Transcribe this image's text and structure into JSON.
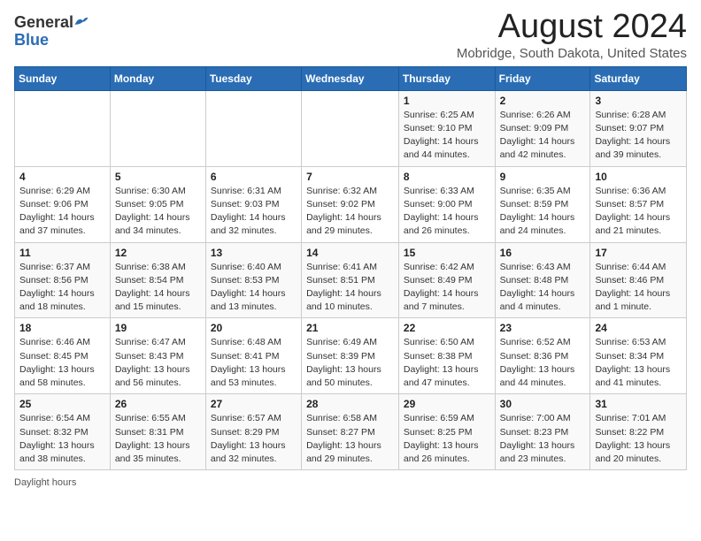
{
  "header": {
    "logo_general": "General",
    "logo_blue": "Blue",
    "main_title": "August 2024",
    "sub_title": "Mobridge, South Dakota, United States"
  },
  "calendar": {
    "days_of_week": [
      "Sunday",
      "Monday",
      "Tuesday",
      "Wednesday",
      "Thursday",
      "Friday",
      "Saturday"
    ],
    "weeks": [
      [
        {
          "day": "",
          "info": ""
        },
        {
          "day": "",
          "info": ""
        },
        {
          "day": "",
          "info": ""
        },
        {
          "day": "",
          "info": ""
        },
        {
          "day": "1",
          "info": "Sunrise: 6:25 AM\nSunset: 9:10 PM\nDaylight: 14 hours and 44 minutes."
        },
        {
          "day": "2",
          "info": "Sunrise: 6:26 AM\nSunset: 9:09 PM\nDaylight: 14 hours and 42 minutes."
        },
        {
          "day": "3",
          "info": "Sunrise: 6:28 AM\nSunset: 9:07 PM\nDaylight: 14 hours and 39 minutes."
        }
      ],
      [
        {
          "day": "4",
          "info": "Sunrise: 6:29 AM\nSunset: 9:06 PM\nDaylight: 14 hours and 37 minutes."
        },
        {
          "day": "5",
          "info": "Sunrise: 6:30 AM\nSunset: 9:05 PM\nDaylight: 14 hours and 34 minutes."
        },
        {
          "day": "6",
          "info": "Sunrise: 6:31 AM\nSunset: 9:03 PM\nDaylight: 14 hours and 32 minutes."
        },
        {
          "day": "7",
          "info": "Sunrise: 6:32 AM\nSunset: 9:02 PM\nDaylight: 14 hours and 29 minutes."
        },
        {
          "day": "8",
          "info": "Sunrise: 6:33 AM\nSunset: 9:00 PM\nDaylight: 14 hours and 26 minutes."
        },
        {
          "day": "9",
          "info": "Sunrise: 6:35 AM\nSunset: 8:59 PM\nDaylight: 14 hours and 24 minutes."
        },
        {
          "day": "10",
          "info": "Sunrise: 6:36 AM\nSunset: 8:57 PM\nDaylight: 14 hours and 21 minutes."
        }
      ],
      [
        {
          "day": "11",
          "info": "Sunrise: 6:37 AM\nSunset: 8:56 PM\nDaylight: 14 hours and 18 minutes."
        },
        {
          "day": "12",
          "info": "Sunrise: 6:38 AM\nSunset: 8:54 PM\nDaylight: 14 hours and 15 minutes."
        },
        {
          "day": "13",
          "info": "Sunrise: 6:40 AM\nSunset: 8:53 PM\nDaylight: 14 hours and 13 minutes."
        },
        {
          "day": "14",
          "info": "Sunrise: 6:41 AM\nSunset: 8:51 PM\nDaylight: 14 hours and 10 minutes."
        },
        {
          "day": "15",
          "info": "Sunrise: 6:42 AM\nSunset: 8:49 PM\nDaylight: 14 hours and 7 minutes."
        },
        {
          "day": "16",
          "info": "Sunrise: 6:43 AM\nSunset: 8:48 PM\nDaylight: 14 hours and 4 minutes."
        },
        {
          "day": "17",
          "info": "Sunrise: 6:44 AM\nSunset: 8:46 PM\nDaylight: 14 hours and 1 minute."
        }
      ],
      [
        {
          "day": "18",
          "info": "Sunrise: 6:46 AM\nSunset: 8:45 PM\nDaylight: 13 hours and 58 minutes."
        },
        {
          "day": "19",
          "info": "Sunrise: 6:47 AM\nSunset: 8:43 PM\nDaylight: 13 hours and 56 minutes."
        },
        {
          "day": "20",
          "info": "Sunrise: 6:48 AM\nSunset: 8:41 PM\nDaylight: 13 hours and 53 minutes."
        },
        {
          "day": "21",
          "info": "Sunrise: 6:49 AM\nSunset: 8:39 PM\nDaylight: 13 hours and 50 minutes."
        },
        {
          "day": "22",
          "info": "Sunrise: 6:50 AM\nSunset: 8:38 PM\nDaylight: 13 hours and 47 minutes."
        },
        {
          "day": "23",
          "info": "Sunrise: 6:52 AM\nSunset: 8:36 PM\nDaylight: 13 hours and 44 minutes."
        },
        {
          "day": "24",
          "info": "Sunrise: 6:53 AM\nSunset: 8:34 PM\nDaylight: 13 hours and 41 minutes."
        }
      ],
      [
        {
          "day": "25",
          "info": "Sunrise: 6:54 AM\nSunset: 8:32 PM\nDaylight: 13 hours and 38 minutes."
        },
        {
          "day": "26",
          "info": "Sunrise: 6:55 AM\nSunset: 8:31 PM\nDaylight: 13 hours and 35 minutes."
        },
        {
          "day": "27",
          "info": "Sunrise: 6:57 AM\nSunset: 8:29 PM\nDaylight: 13 hours and 32 minutes."
        },
        {
          "day": "28",
          "info": "Sunrise: 6:58 AM\nSunset: 8:27 PM\nDaylight: 13 hours and 29 minutes."
        },
        {
          "day": "29",
          "info": "Sunrise: 6:59 AM\nSunset: 8:25 PM\nDaylight: 13 hours and 26 minutes."
        },
        {
          "day": "30",
          "info": "Sunrise: 7:00 AM\nSunset: 8:23 PM\nDaylight: 13 hours and 23 minutes."
        },
        {
          "day": "31",
          "info": "Sunrise: 7:01 AM\nSunset: 8:22 PM\nDaylight: 13 hours and 20 minutes."
        }
      ]
    ]
  },
  "footer": {
    "daylight_hours": "Daylight hours"
  }
}
